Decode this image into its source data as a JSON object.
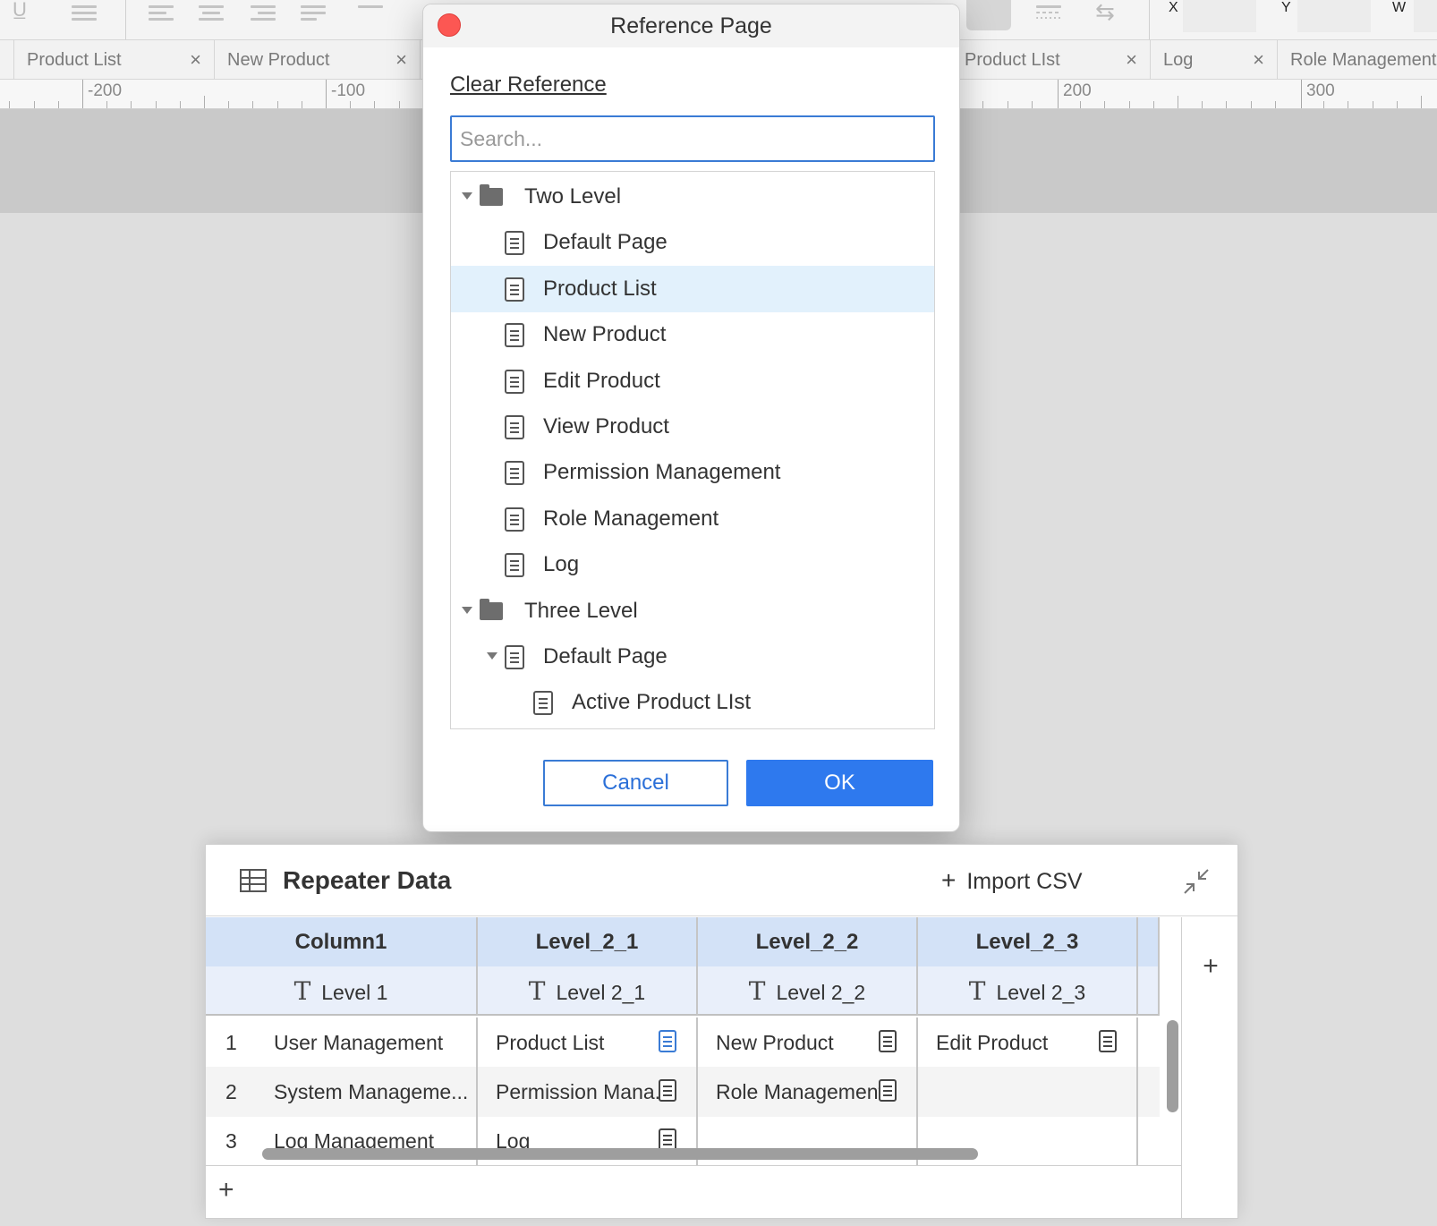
{
  "toolbar": {
    "x_label": "X",
    "y_label": "Y",
    "w_label": "W"
  },
  "tabs": [
    {
      "label": "Product List"
    },
    {
      "label": "New Product"
    },
    {
      "label": "Product LIst"
    },
    {
      "label": "Log"
    },
    {
      "label": "Role Management"
    }
  ],
  "tab_close": "×",
  "ruler": {
    "labels": [
      "-200",
      "-100",
      "200",
      "300"
    ]
  },
  "dialog": {
    "title": "Reference Page",
    "clear_reference": "Clear Reference",
    "search_placeholder": "Search...",
    "tree": [
      {
        "label": "Two Level",
        "type": "folder",
        "level": 0,
        "expanded": true
      },
      {
        "label": "Default Page",
        "type": "page",
        "level": 1
      },
      {
        "label": "Product List",
        "type": "page",
        "level": 1,
        "selected": true
      },
      {
        "label": "New Product",
        "type": "page",
        "level": 1
      },
      {
        "label": "Edit Product",
        "type": "page",
        "level": 1
      },
      {
        "label": "View Product",
        "type": "page",
        "level": 1
      },
      {
        "label": "Permission Management",
        "type": "page",
        "level": 1
      },
      {
        "label": "Role Management",
        "type": "page",
        "level": 1
      },
      {
        "label": "Log",
        "type": "page",
        "level": 1
      },
      {
        "label": "Three Level",
        "type": "folder",
        "level": 0,
        "expanded": true
      },
      {
        "label": "Default Page",
        "type": "page",
        "level": 1,
        "expanded": true
      },
      {
        "label": "Active Product LIst",
        "type": "page",
        "level": 2
      }
    ],
    "cancel_label": "Cancel",
    "ok_label": "OK"
  },
  "repeater": {
    "title": "Repeater Data",
    "import_label": "Import CSV",
    "plus": "+",
    "columns": [
      {
        "name": "Column1",
        "type_label": "Level 1"
      },
      {
        "name": "Level_2_1",
        "type_label": "Level 2_1"
      },
      {
        "name": "Level_2_2",
        "type_label": "Level 2_2"
      },
      {
        "name": "Level_2_3",
        "type_label": "Level 2_3"
      }
    ],
    "type_glyph": "T",
    "rows": [
      {
        "num": "1",
        "cells": [
          "User Management",
          "Product List",
          "New Product",
          "Edit Product"
        ]
      },
      {
        "num": "2",
        "cells": [
          "System Manageme...",
          "Permission Mana...",
          "Role Management",
          ""
        ]
      },
      {
        "num": "3",
        "cells": [
          "Log Management",
          "Log",
          "",
          ""
        ]
      }
    ]
  }
}
